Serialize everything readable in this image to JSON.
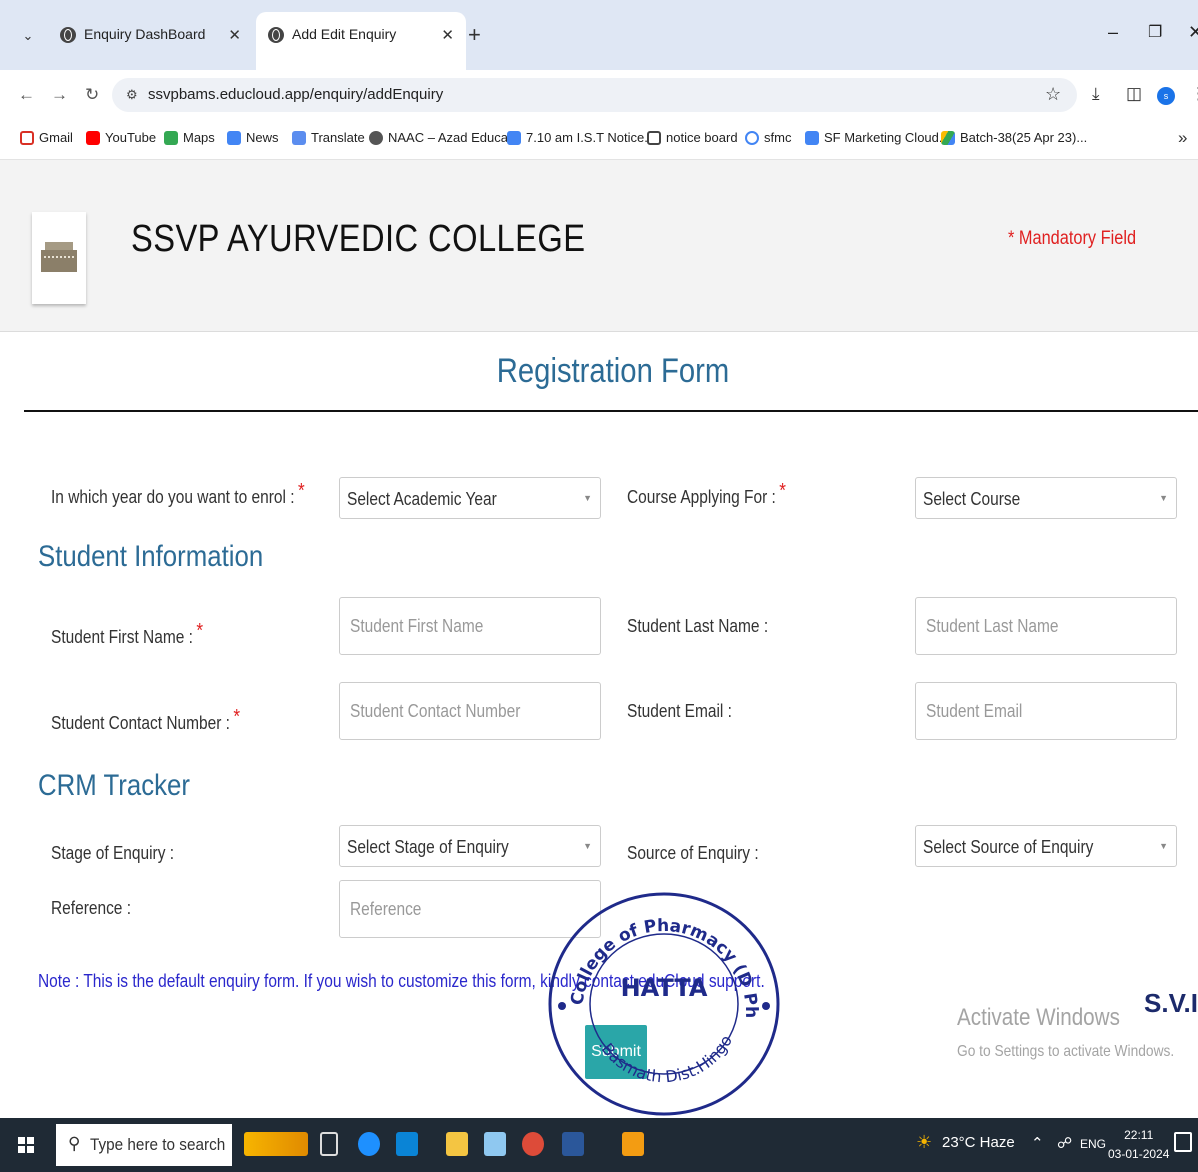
{
  "browser": {
    "tabs": [
      {
        "title": "Enquiry DashBoard",
        "active": false
      },
      {
        "title": "Add Edit Enquiry",
        "active": true
      }
    ],
    "url": "ssvpbams.educloud.app/enquiry/addEnquiry",
    "profile_initial": "s",
    "bookmarks": [
      {
        "label": "Gmail",
        "icon": "gmail-icon"
      },
      {
        "label": "YouTube",
        "icon": "youtube-icon"
      },
      {
        "label": "Maps",
        "icon": "maps-icon"
      },
      {
        "label": "News",
        "icon": "news-icon"
      },
      {
        "label": "Translate",
        "icon": "translate-icon"
      },
      {
        "label": "NAAC – Azad Educa...",
        "icon": "globe-icon"
      },
      {
        "label": "7.10 am I.S.T Notice...",
        "icon": "docs-icon"
      },
      {
        "label": "notice board",
        "icon": "folder-icon"
      },
      {
        "label": "sfmc",
        "icon": "google-icon"
      },
      {
        "label": "SF Marketing Cloud...",
        "icon": "docs-icon"
      },
      {
        "label": "Batch-38(25 Apr 23)...",
        "icon": "drive-icon"
      }
    ],
    "more_bookmarks": "»"
  },
  "header": {
    "college_name": "SSVP AYURVEDIC COLLEGE",
    "mandatory_note": "* Mandatory Field"
  },
  "form": {
    "title": "Registration Form",
    "required_mark": "*",
    "enrol_year_label": "In which year do you want to enrol :",
    "enrol_year_value": "Select Academic Year",
    "course_label": "Course Applying For :",
    "course_value": "Select Course",
    "student_info_title": "Student Information",
    "first_name_label": "Student First Name :",
    "first_name_placeholder": "Student First Name",
    "last_name_label": "Student Last Name :",
    "last_name_placeholder": "Student Last Name",
    "contact_label": "Student Contact Number :",
    "contact_placeholder": "Student Contact Number",
    "email_label": "Student Email :",
    "email_placeholder": "Student Email",
    "crm_title": "CRM Tracker",
    "stage_label": "Stage of Enquiry :",
    "stage_value": "Select Stage of Enquiry",
    "source_label": "Source of Enquiry :",
    "source_value": "Select Source of Enquiry",
    "reference_label": "Reference :",
    "reference_placeholder": "Reference",
    "note": "Note : This is the default enquiry form. If you wish to customize this form, kindly contact eduCloud support.",
    "submit_label": "Submit"
  },
  "stamp": {
    "top_text": "S.V.P. College of Pharmacy (D Pharm)",
    "center_text": "HATTA",
    "bottom_text": "Tq.Basmath Dist.Hingoli."
  },
  "overlay": {
    "activate_title": "Activate Windows",
    "activate_sub": "Go to Settings to activate Windows.",
    "partial_logo": "S.V.I"
  },
  "taskbar": {
    "search_placeholder": "Type here to search",
    "weather": "23°C  Haze",
    "language": "ENG",
    "time": "22:11",
    "date": "03-01-2024"
  },
  "colors": {
    "heading_blue": "#2c6b95",
    "required_red": "#e02020",
    "note_blue": "#2a27cc",
    "submit_teal": "#2aa6a8",
    "stamp_blue": "#1f2a8a"
  }
}
